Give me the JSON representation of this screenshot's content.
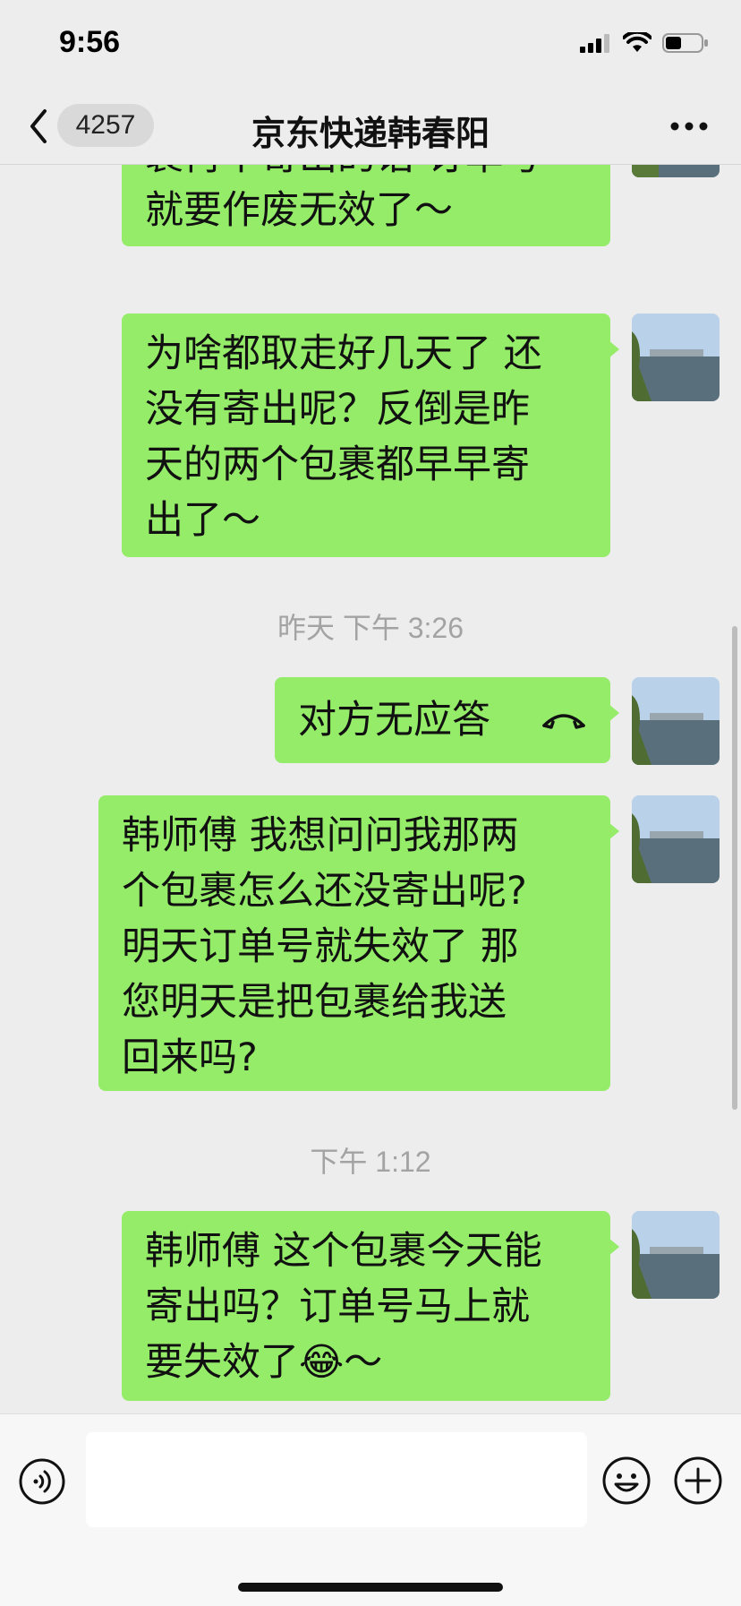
{
  "status_bar": {
    "time": "9:56",
    "battery_level": 0.45
  },
  "nav": {
    "unread_count": "4257",
    "title": "京东快递韩春阳",
    "icons": {
      "back": "chevron-left-icon",
      "more": "more-dots-icon"
    }
  },
  "messages": [
    {
      "text_lines": [
        "裹再不寄出的话 订单号",
        "就要作废无效了～"
      ]
    },
    {
      "text_lines": [
        "为啥都取走好几天了 还",
        "没有寄出呢？反倒是昨",
        "天的两个包裹都早早寄",
        "出了～"
      ]
    },
    {
      "timestamp": "昨天 下午 3:26"
    },
    {
      "call_text": "对方无应答",
      "icon": "hangup-phone-icon"
    },
    {
      "text_lines": [
        "韩师傅 我想问问我那两",
        "个包裹怎么还没寄出呢?",
        "明天订单号就失效了 那",
        "您明天是把包裹给我送",
        "回来吗?"
      ]
    },
    {
      "timestamp": "下午 1:12"
    },
    {
      "text_lines": [
        "韩师傅 这个包裹今天能",
        "寄出吗？订单号马上就",
        "要失效了"
      ],
      "trailing_emoji": "😂",
      "trailing_text": "～"
    }
  ],
  "input_bar": {
    "icons": {
      "voice": "voice-input-icon",
      "emoji": "emoji-icon",
      "plus": "plus-icon"
    },
    "value": ""
  },
  "colors": {
    "bubble": "#95ec69",
    "background": "#ededed",
    "timestamp": "#a3a3a3"
  }
}
